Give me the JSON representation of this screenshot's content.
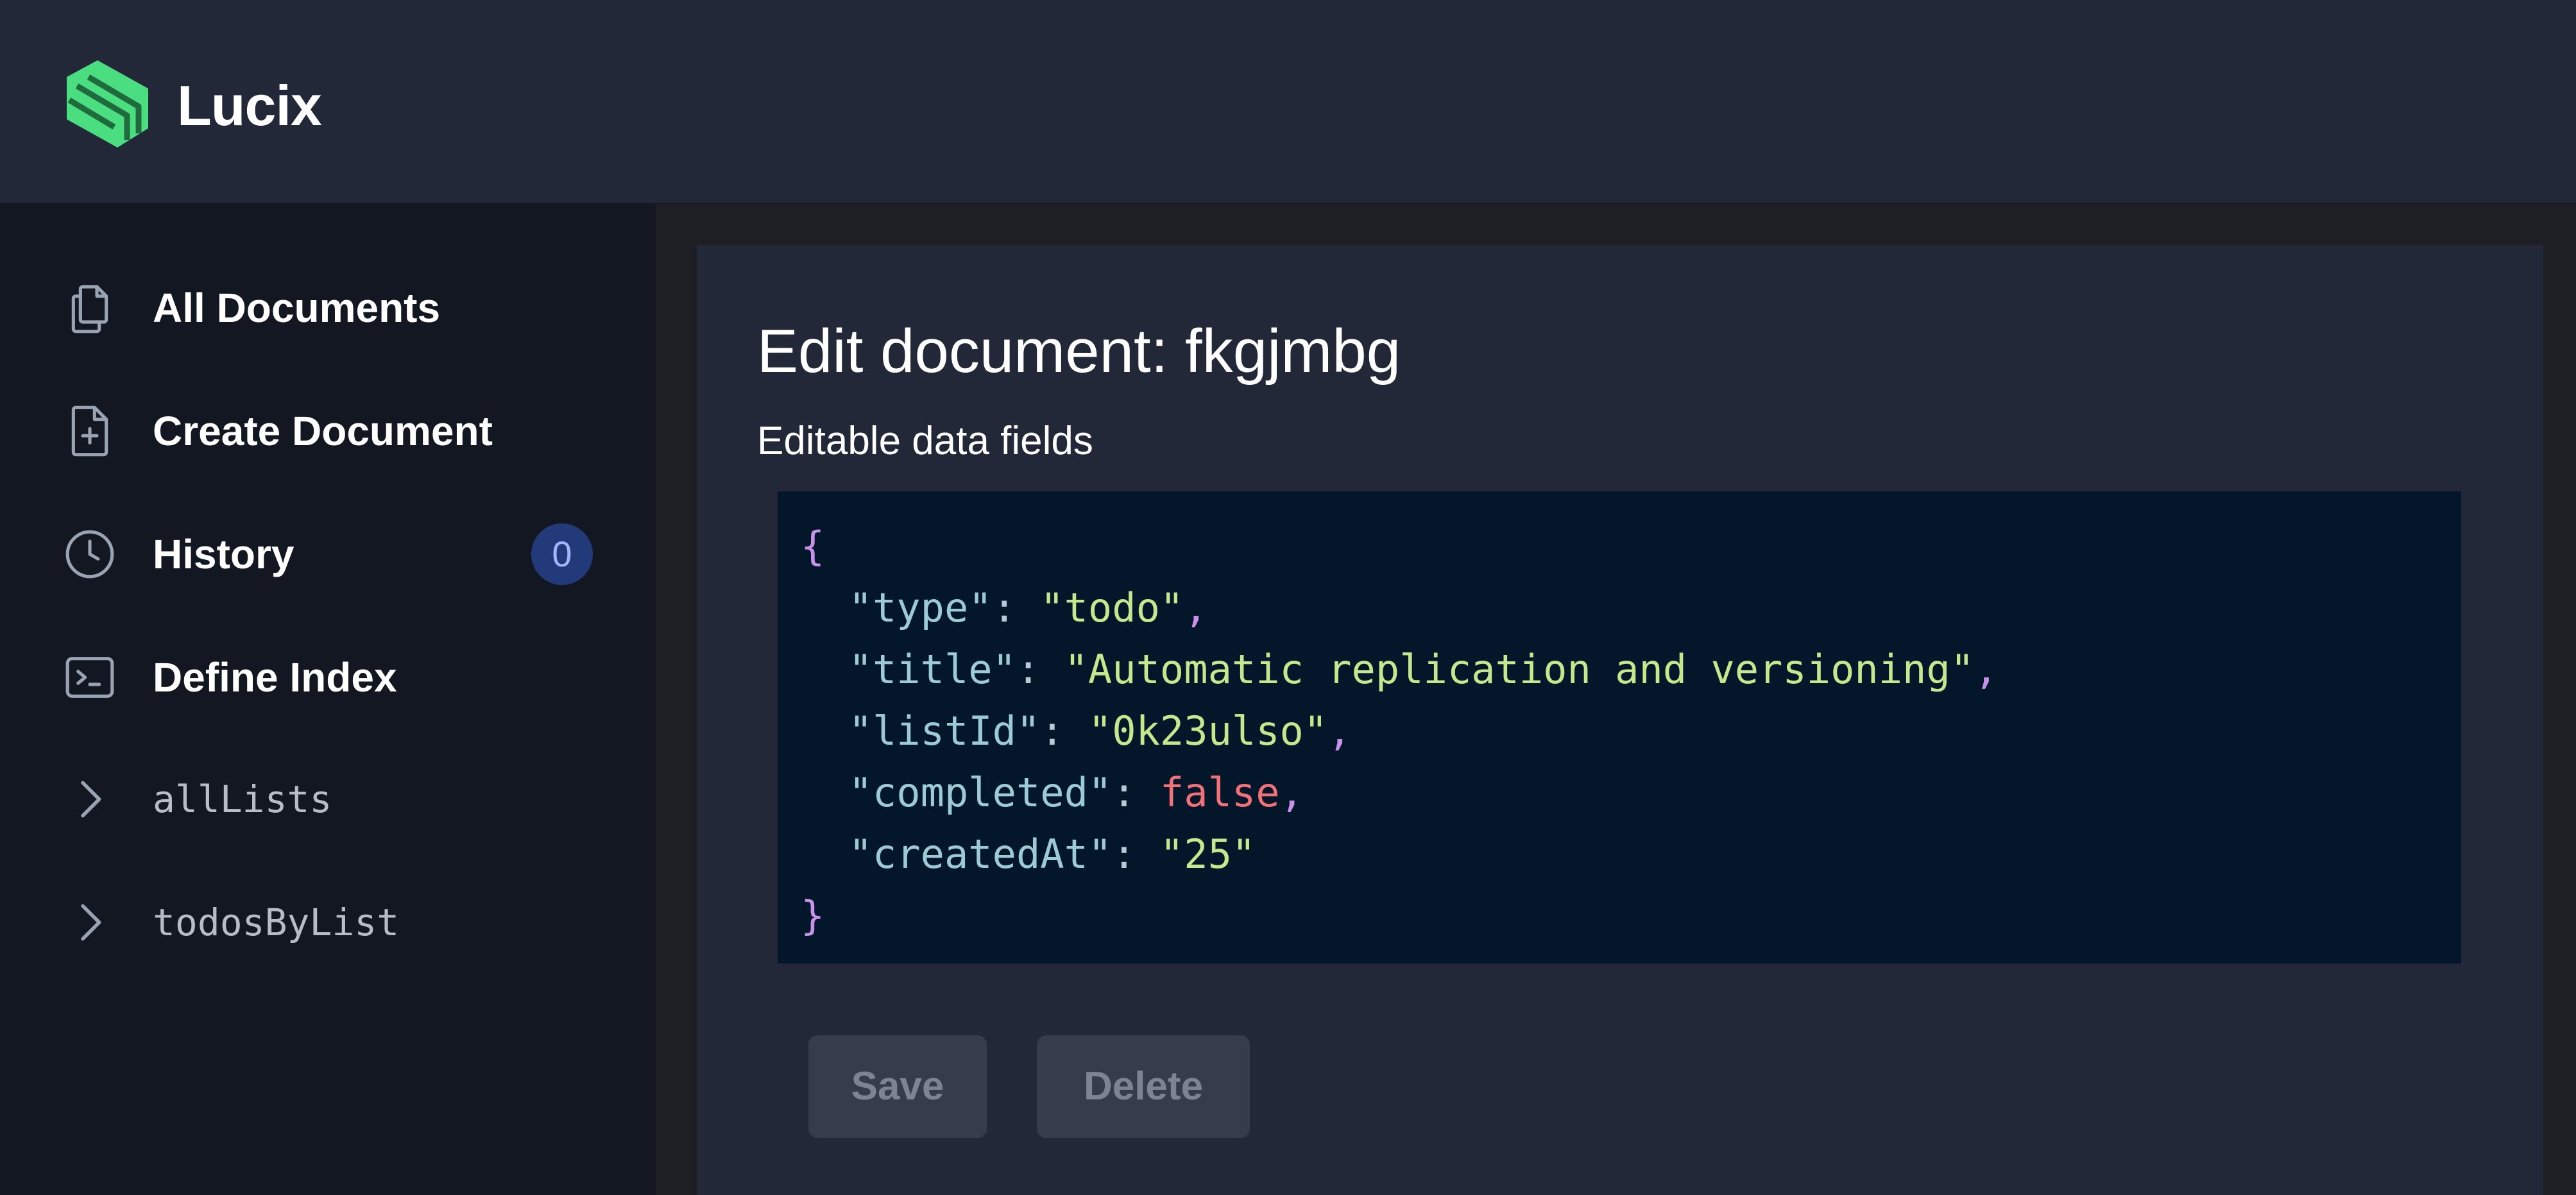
{
  "app": {
    "name": "Lucix",
    "brand_color": "#4ade80"
  },
  "sidebar": {
    "items": [
      {
        "label": "All Documents",
        "icon": "documents-icon"
      },
      {
        "label": "Create Document",
        "icon": "file-plus-icon"
      },
      {
        "label": "History",
        "icon": "clock-icon",
        "badge": "0"
      },
      {
        "label": "Define Index",
        "icon": "terminal-icon"
      }
    ],
    "indexes": [
      {
        "label": "allLists",
        "icon": "chevron-right-icon"
      },
      {
        "label": "todosByList",
        "icon": "chevron-right-icon"
      }
    ]
  },
  "main": {
    "title": "Edit document: fkgjmbg",
    "subtitle": "Editable data fields",
    "editor": {
      "open_brace": "{",
      "close_brace": "}",
      "fields": [
        {
          "key": "\"type\"",
          "value": "\"todo\"",
          "value_kind": "string"
        },
        {
          "key": "\"title\"",
          "value": "\"Automatic replication and versioning\"",
          "value_kind": "string"
        },
        {
          "key": "\"listId\"",
          "value": "\"0k23ulso\"",
          "value_kind": "string"
        },
        {
          "key": "\"completed\"",
          "value": "false",
          "value_kind": "boolean"
        },
        {
          "key": "\"createdAt\"",
          "value": "\"25\"",
          "value_kind": "string"
        }
      ]
    },
    "buttons": {
      "save": "Save",
      "delete": "Delete"
    }
  }
}
